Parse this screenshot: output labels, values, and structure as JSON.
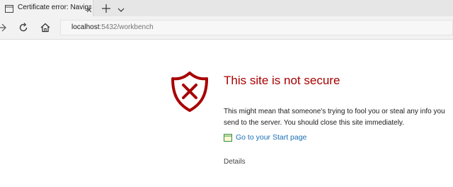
{
  "browser": {
    "tab": {
      "title": "Certificate error: Naviga",
      "icon": "page-icon"
    },
    "toolbar": {
      "icons": [
        "forward-icon",
        "refresh-icon",
        "home-icon"
      ],
      "address": {
        "host": "localhost",
        "path": ":5432/workbench"
      }
    }
  },
  "page": {
    "heading": "This site is not secure",
    "message": "This might mean that someone's trying to fool you or steal any info you send to the server. You should close this site immediately.",
    "start_link": "Go to your Start page",
    "details": "Details"
  },
  "colors": {
    "warning_red": "#a80000",
    "link_blue": "#1a6fb4",
    "chrome_gray": "#f2f2f2"
  }
}
